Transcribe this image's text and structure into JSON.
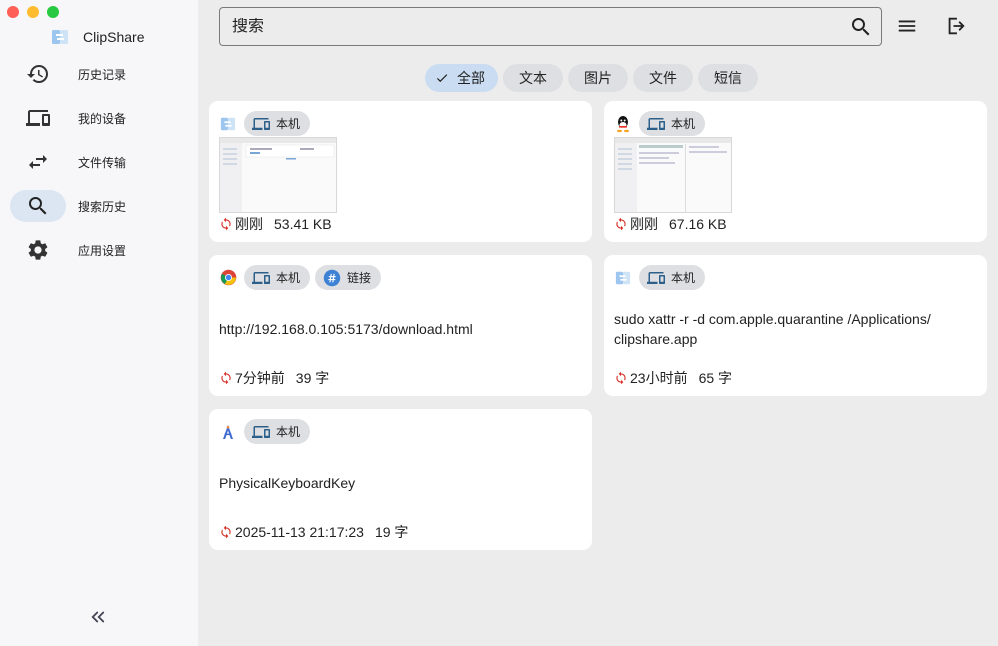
{
  "app": {
    "name": "ClipShare"
  },
  "sidebar": {
    "items": [
      {
        "label": "历史记录",
        "icon": "history-icon",
        "active": false
      },
      {
        "label": "我的设备",
        "icon": "devices-icon",
        "active": false
      },
      {
        "label": "文件传输",
        "icon": "transfer-icon",
        "active": false
      },
      {
        "label": "搜索历史",
        "icon": "search-icon",
        "active": true
      },
      {
        "label": "应用设置",
        "icon": "gear-icon",
        "active": false
      }
    ]
  },
  "search": {
    "placeholder": "搜索",
    "value": ""
  },
  "filters": [
    "全部",
    "文本",
    "图片",
    "文件",
    "短信"
  ],
  "colors": {
    "accent": "#c9dcf1",
    "refresh": "#d9342b",
    "brand": "#6aa6de"
  },
  "cards": [
    {
      "app_icon": "clipshare-app-icon",
      "tags": [
        "本机"
      ],
      "time": "刚刚",
      "meta": "53.41 KB"
    },
    {
      "app_icon": "qq-app-icon",
      "tags": [
        "本机"
      ],
      "time": "刚刚",
      "meta": "67.16 KB"
    },
    {
      "app_icon": "chrome-app-icon",
      "tags": [
        "本机",
        "链接"
      ],
      "content": "http://192.168.0.105:5173/download.html",
      "time": "7分钟前",
      "meta": "39 字"
    },
    {
      "app_icon": "clipshare-app-icon",
      "tags": [
        "本机"
      ],
      "content_lines": [
        "sudo xattr -r -d com.apple.quarantine /Applications/",
        "clipshare.app"
      ],
      "time": "23小时前",
      "meta": "65 字"
    },
    {
      "app_icon": "android-studio-app-icon",
      "tags": [
        "本机"
      ],
      "content": "PhysicalKeyboardKey",
      "time": "2025-11-13 21:17:23",
      "meta": "19 字"
    }
  ]
}
